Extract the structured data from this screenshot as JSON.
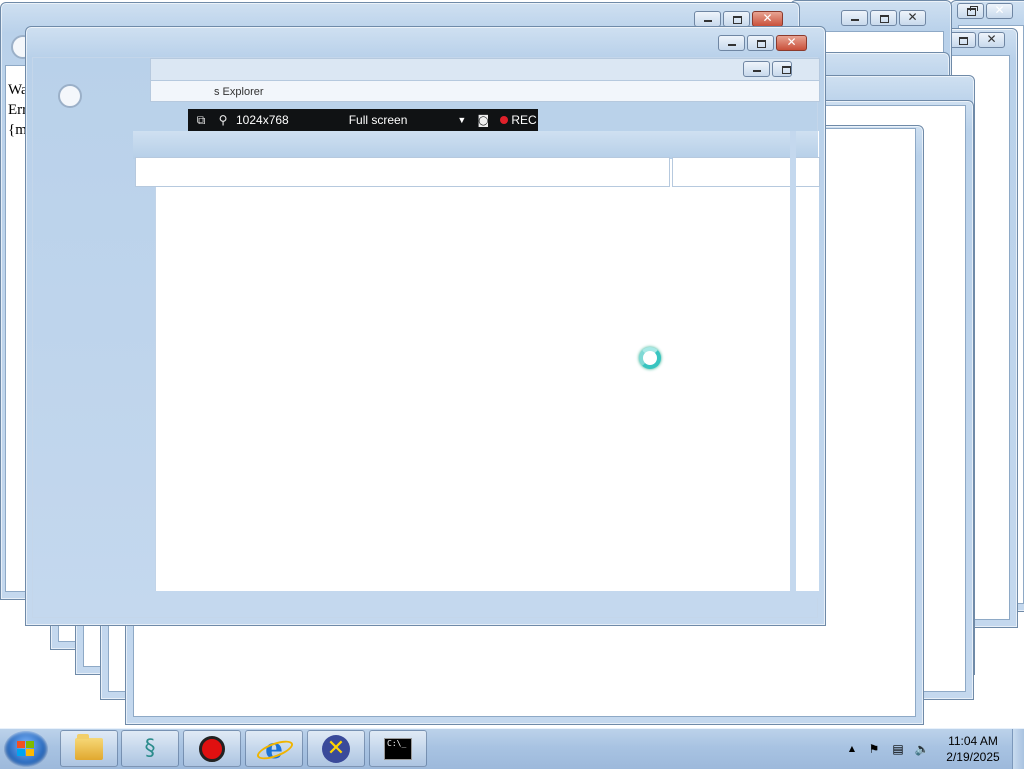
{
  "background_windows": {
    "error_lines": [
      "Warning",
      "Error: C",
      "{main}"
    ],
    "explorer_title_fragment": "s Explorer"
  },
  "recorder_toolbar": {
    "restore_icon": "restore-icon",
    "zoom_icon": "magnifier-icon",
    "resolution": "1024x768",
    "mode": "Full screen",
    "dropdown_icon": "triangle-down-icon",
    "camera_icon": "camera-icon",
    "rec_label": "REC",
    "rec_color": "#e0202a"
  },
  "cursor": {
    "state": "busy"
  },
  "taskbar": {
    "pinned": [
      {
        "name": "windows-explorer",
        "icon": "folder-icon"
      },
      {
        "name": "dragon-app",
        "icon": "dragon-icon"
      },
      {
        "name": "screen-recorder",
        "icon": "red-record-icon"
      },
      {
        "name": "internet-explorer",
        "icon": "ie-icon"
      },
      {
        "name": "x-app",
        "icon": "x-badge-icon"
      },
      {
        "name": "command-prompt",
        "icon": "cmd-icon",
        "glyph": "C:\\_"
      }
    ],
    "tray": {
      "show_hidden": "▲",
      "time": "11:04 AM",
      "date": "2/19/2025"
    }
  },
  "colors": {
    "taskbar": "#a8c3e2",
    "window_frame": "#b9d1ea",
    "close_button": "#c9503a",
    "busy_cursor": "#38c4c0"
  }
}
